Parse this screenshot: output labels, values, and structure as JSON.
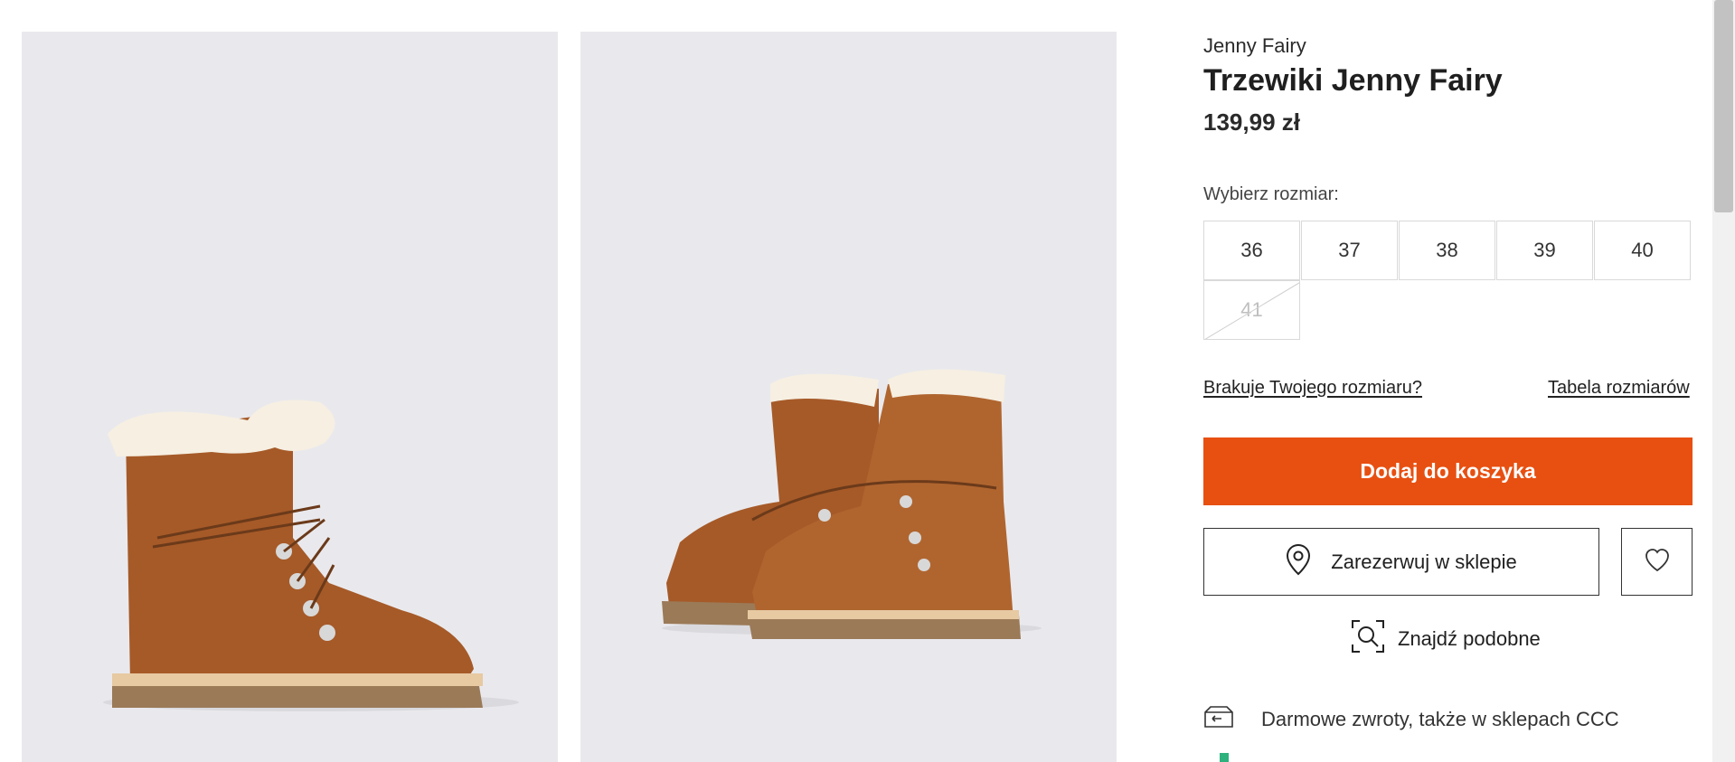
{
  "product": {
    "brand": "Jenny Fairy",
    "title": "Trzewiki Jenny Fairy",
    "price": "139,99 zł"
  },
  "sizes": {
    "label": "Wybierz rozmiar:",
    "options": [
      {
        "value": "36",
        "available": true
      },
      {
        "value": "37",
        "available": true
      },
      {
        "value": "38",
        "available": true
      },
      {
        "value": "39",
        "available": true
      },
      {
        "value": "40",
        "available": true
      },
      {
        "value": "41",
        "available": false
      }
    ]
  },
  "links": {
    "missing_size": "Brakuje Twojego rozmiaru?",
    "size_chart": "Tabela rozmiarów"
  },
  "actions": {
    "add_to_cart": "Dodaj do koszyka",
    "reserve_in_store": "Zarezerwuj w sklepie",
    "find_similar": "Znajdź podobne"
  },
  "benefits": [
    {
      "icon": "return-box-icon",
      "text": "Darmowe zwroty, także w sklepach CCC"
    }
  ],
  "colors": {
    "accent": "#e75011",
    "gallery_bg": "#e9e9ed",
    "boot": "#a65a28",
    "fur": "#f6efe2",
    "sole": "#9b7a58"
  }
}
